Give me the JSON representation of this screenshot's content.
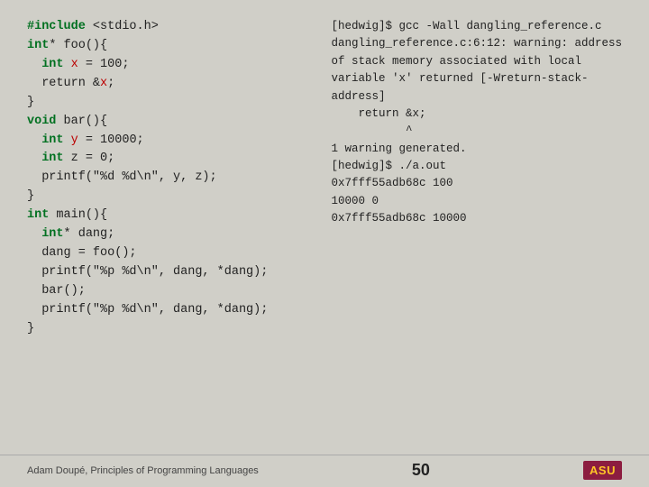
{
  "slide": {
    "code": {
      "lines": [
        {
          "text": "#include <stdio.h>",
          "type": "normal"
        },
        {
          "text": "int* foo(){",
          "type": "normal"
        },
        {
          "text": "  int x = 100;",
          "type": "normal"
        },
        {
          "text": "  return &x;",
          "type": "normal"
        },
        {
          "text": "}",
          "type": "normal"
        },
        {
          "text": "void bar(){",
          "type": "normal"
        },
        {
          "text": "  int y = 10000;",
          "type": "normal"
        },
        {
          "text": "  int z = 0;",
          "type": "normal"
        },
        {
          "text": "  printf(\"%d %d\\n\", y, z);",
          "type": "normal"
        },
        {
          "text": "}",
          "type": "normal"
        },
        {
          "text": "int main(){",
          "type": "normal"
        },
        {
          "text": "  int* dang;",
          "type": "normal"
        },
        {
          "text": "  dang = foo();",
          "type": "normal"
        },
        {
          "text": "  printf(\"%p %d\\n\", dang, *dang);",
          "type": "normal"
        },
        {
          "text": "  bar();",
          "type": "normal"
        },
        {
          "text": "  printf(\"%p %d\\n\", dang, *dang);",
          "type": "normal"
        },
        {
          "text": "}",
          "type": "normal"
        }
      ]
    },
    "terminal": {
      "lines": [
        "[hedwig]$ gcc -Wall dangling_reference.c",
        "dangling_reference.c:6:12: warning: address",
        "of stack memory associated with local",
        "variable 'x' returned [-Wreturn-stack-",
        "address]",
        "    return &x;",
        "           ^",
        "1 warning generated.",
        "[hedwig]$ ./a.out",
        "0x7fff55adb68c 100",
        "10000 0",
        "0x7fff55adb68c 10000"
      ]
    },
    "footer": {
      "credit": "Adam Doupé, Principles of Programming Languages",
      "page": "50",
      "logo": "ASU"
    }
  }
}
